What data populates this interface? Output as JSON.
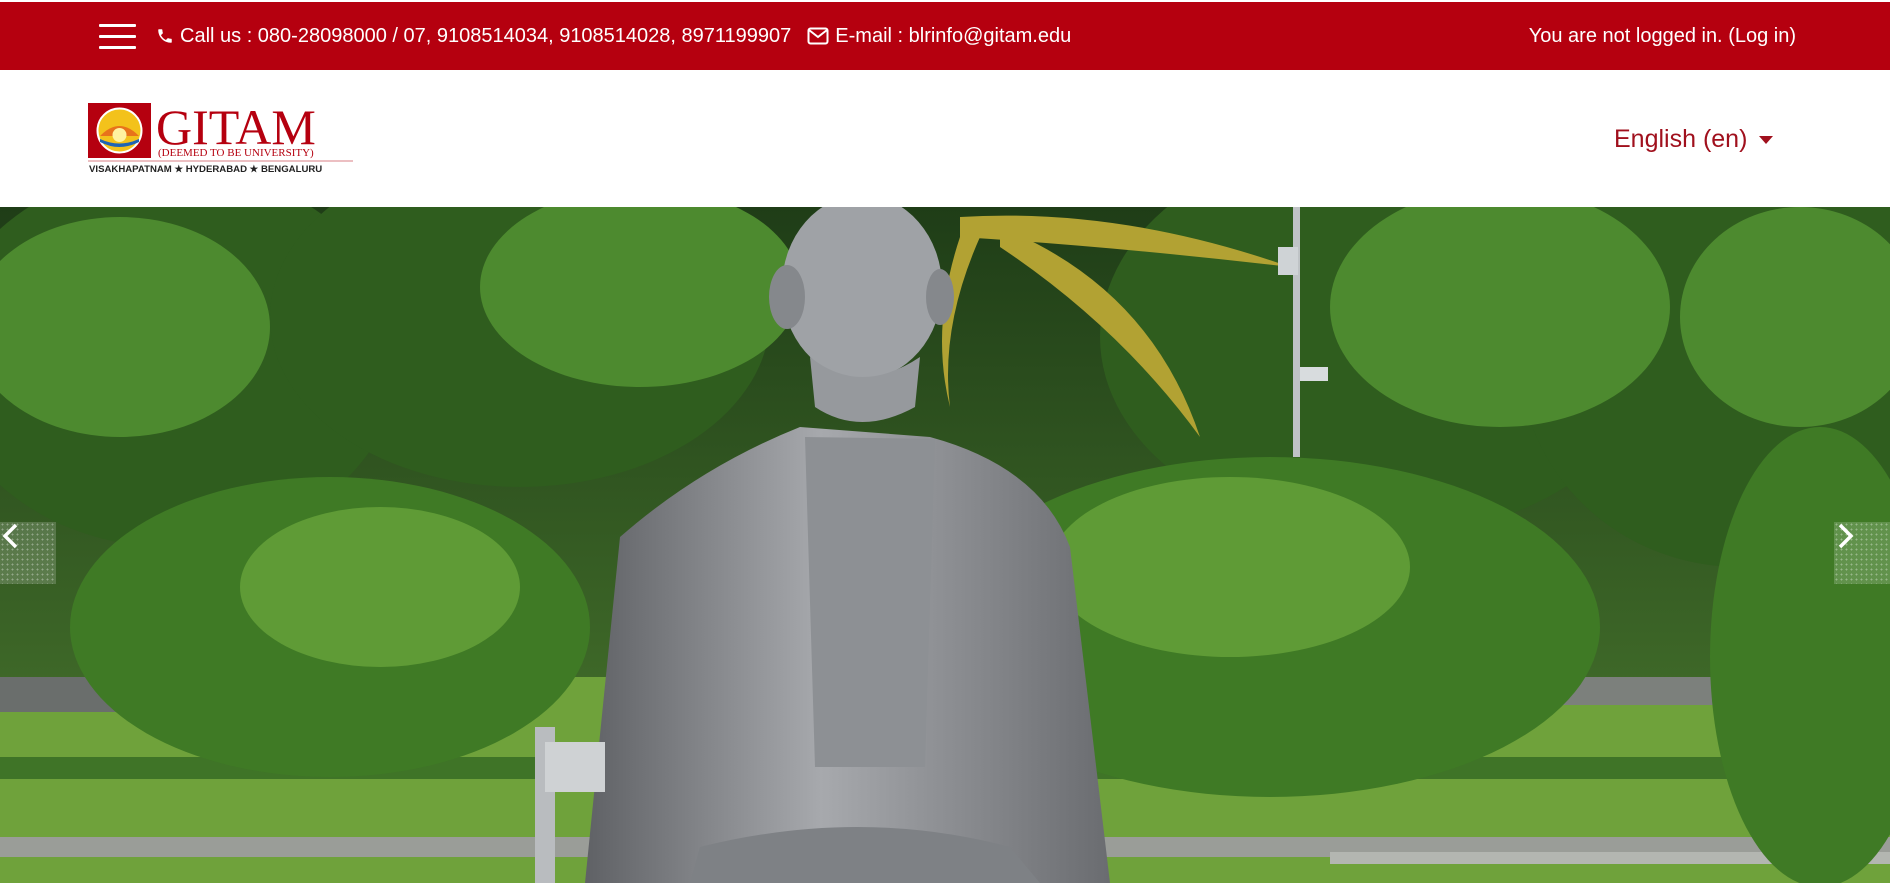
{
  "topbar": {
    "call_text": "Call us : 080-28098000 / 07, 9108514034, 9108514028, 8971199907",
    "email_text": "E-mail : blrinfo@gitam.edu",
    "login_prefix": "You are not logged in. ",
    "login_link": "(Log in)",
    "bg_color": "#b5000f"
  },
  "header": {
    "logo": {
      "name": "GITAM",
      "subtitle": "(DEEMED TO BE UNIVERSITY)",
      "campuses": "VISAKHAPATNAM ★ HYDERABAD ★ BENGALURU"
    },
    "language": "English (en)"
  },
  "slider": {
    "prev_icon": "chevron-left-icon",
    "next_icon": "chevron-right-icon"
  }
}
